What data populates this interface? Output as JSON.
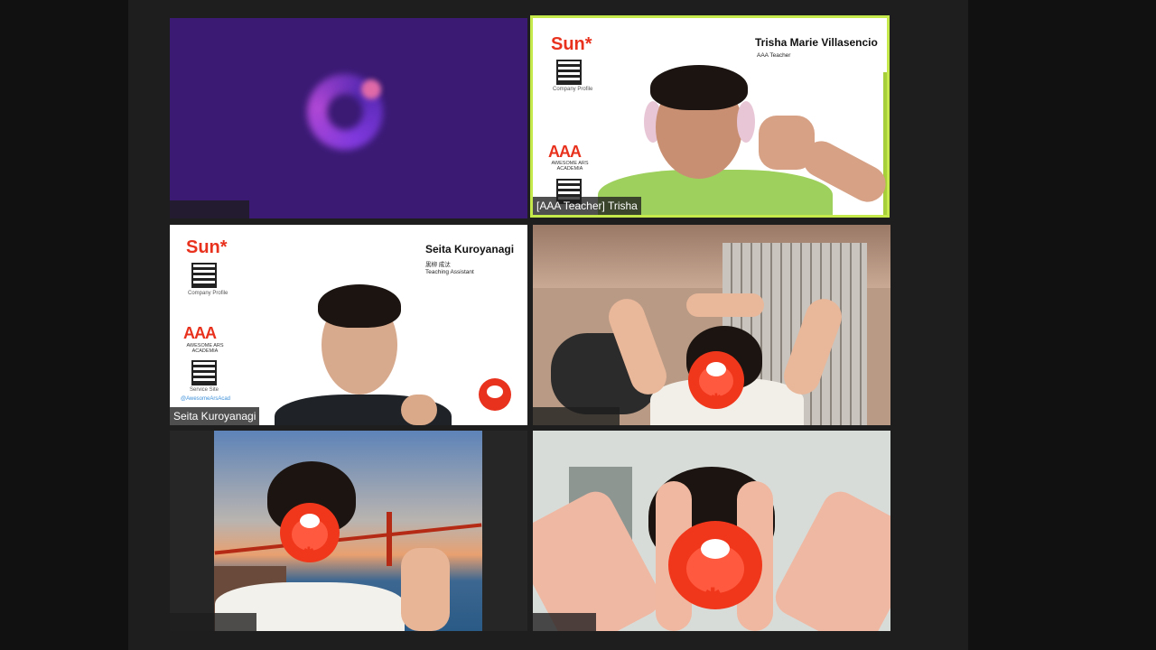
{
  "tiles": [
    {
      "id": "tile-1",
      "kind": "logo",
      "name_label": ""
    },
    {
      "id": "tile-2",
      "kind": "teacher",
      "name_label": "[AAA Teacher] Trisha",
      "card": {
        "brand": "Sun*",
        "person_name": "Trisha Marie Villasencio",
        "person_role": "AAA Teacher",
        "company_caption": "Company Profile",
        "academy": "AAA",
        "academy_sub": "AWESOME ARS ACADEMIA"
      }
    },
    {
      "id": "tile-3",
      "kind": "assistant",
      "name_label": "Seita Kuroyanagi",
      "card": {
        "brand": "Sun*",
        "person_name": "Seita Kuroyanagi",
        "person_name_jp": "黒柳 成汰",
        "person_role": "Teaching Assistant",
        "company_caption": "Company Profile",
        "academy": "AAA",
        "academy_sub": "AWESOME ARS ACADEMIA",
        "service_caption": "Service Site",
        "social": "@AwesomeArsAcad"
      }
    },
    {
      "id": "tile-4",
      "kind": "student",
      "name_label": ""
    },
    {
      "id": "tile-5",
      "kind": "student",
      "name_label": ""
    },
    {
      "id": "tile-6",
      "kind": "student",
      "name_label": ""
    }
  ],
  "colors": {
    "active_speaker_border": "#c5e84a",
    "brand_red": "#e8321e",
    "background": "#111111"
  },
  "icons": {
    "mask": "bear-face-icon"
  }
}
